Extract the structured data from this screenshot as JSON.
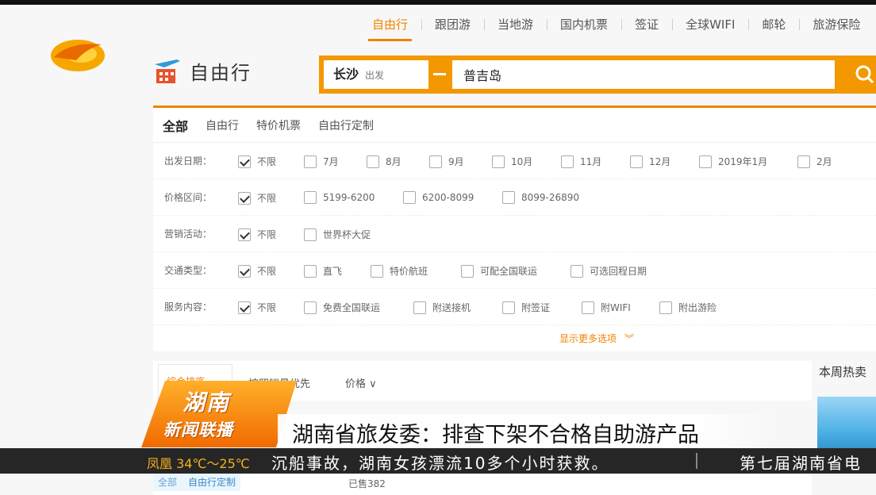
{
  "top_nav": {
    "items": [
      "自由行",
      "跟团游",
      "当地游",
      "国内机票",
      "签证",
      "全球WIFI",
      "邮轮",
      "旅游保险"
    ],
    "active_index": 0
  },
  "brand": {
    "name": "自由行"
  },
  "search": {
    "from_city": "长沙",
    "from_hint": "出发",
    "to_value": "普吉岛"
  },
  "category_tabs": [
    "全部",
    "自由行",
    "特价机票",
    "自由行定制"
  ],
  "filters": [
    {
      "label": "出发日期：",
      "options": [
        "不限",
        "7月",
        "8月",
        "9月",
        "10月",
        "11月",
        "12月",
        "2019年1月",
        "2月"
      ],
      "checked": [
        0
      ]
    },
    {
      "label": "价格区间：",
      "options": [
        "不限",
        "5199-6200",
        "6200-8099",
        "8099-26890"
      ],
      "checked": [
        0
      ]
    },
    {
      "label": "营销活动：",
      "options": [
        "不限",
        "世界杯大促"
      ],
      "checked": [
        0
      ]
    },
    {
      "label": "交通类型：",
      "options": [
        "不限",
        "直飞",
        "特价航班",
        "可配全国联运",
        "可选回程日期"
      ],
      "checked": [
        0
      ]
    },
    {
      "label": "服务内容：",
      "options": [
        "不限",
        "免费全国联运",
        "附送接机",
        "附签证",
        "附WIFI",
        "附出游险"
      ],
      "checked": [
        0
      ]
    }
  ],
  "more_options": "显示更多选项",
  "sort_bar": {
    "first": "综合排序",
    "items": [
      "按照销量优先",
      "价格"
    ]
  },
  "right_panel": {
    "title": "本周热卖"
  },
  "peek_row": {
    "tag_prefix": "全部",
    "tag": "自由行定制",
    "count": "已售382"
  },
  "tv": {
    "logo_line1": "湖南",
    "logo_line2": "新闻联播",
    "headline": "湖南省旅发委：排查下架不合格自助游产品",
    "weather": "凤凰 34℃～25℃",
    "ticker": "沉船事故，湖南女孩漂流10多个小时获救。",
    "ticker_next": "第七届湖南省电"
  },
  "colors": {
    "accent": "#f08300",
    "search_bar": "#f39800",
    "ticker_bg": "#262626",
    "weather": "#f3b11c"
  }
}
